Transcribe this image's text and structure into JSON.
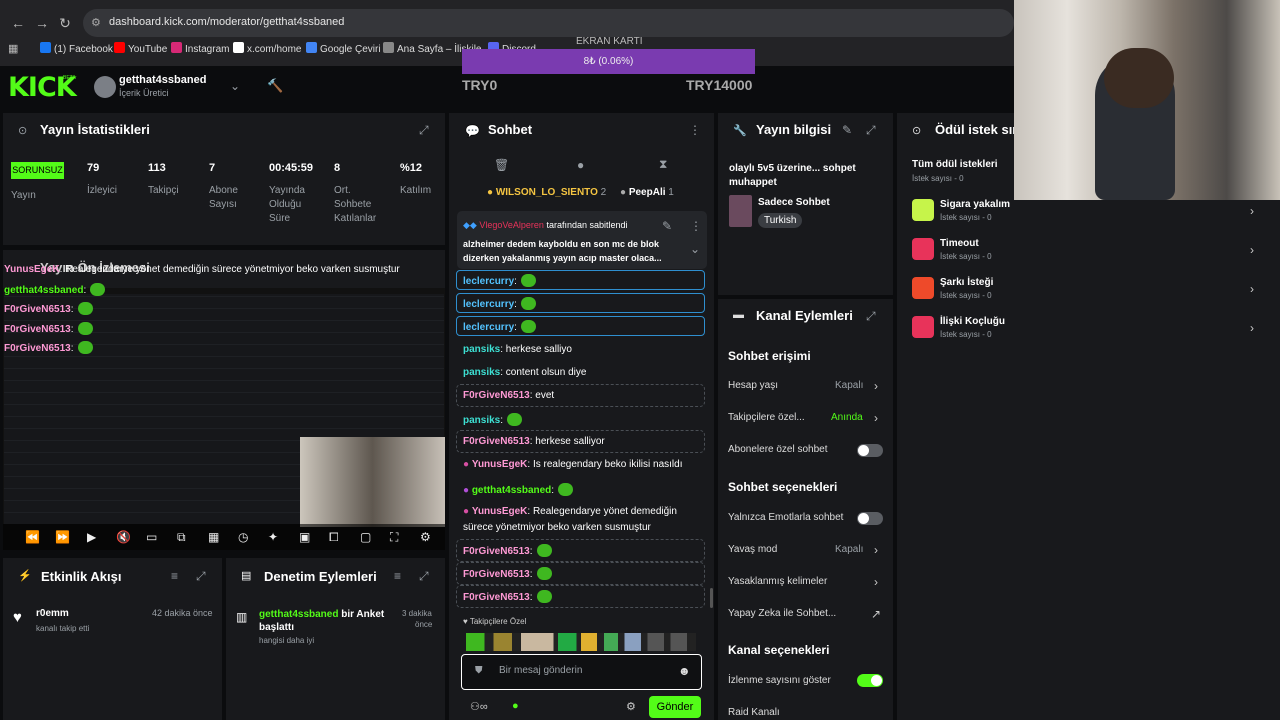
{
  "browser": {
    "url": "dashboard.kick.com/moderator/getthat4ssbaned",
    "bookmarks": [
      {
        "label": "(1) Facebook",
        "color": "#1877f2"
      },
      {
        "label": "YouTube",
        "color": "#ff0000"
      },
      {
        "label": "Instagram",
        "color": "#d62976"
      },
      {
        "label": "x.com/home",
        "color": "#ffffff"
      },
      {
        "label": "Google Çeviri",
        "color": "#4285f4"
      },
      {
        "label": "Ana Sayfa – İlişkile",
        "color": "#888888"
      },
      {
        "label": "Discord",
        "color": "#5865f2"
      }
    ]
  },
  "overlay": {
    "title": "EKRAN KARTI",
    "progress_label": "8₺ (0.06%)",
    "progress": 0.06,
    "min_label": "TRY0",
    "max_label": "TRY14000"
  },
  "header": {
    "logo": "KICK",
    "beta": "BETA",
    "username": "getthat4ssbaned",
    "role": "İçerik Üretici"
  },
  "stats": {
    "title": "Yayın İstatistikleri",
    "badge": "SORUNSUZ",
    "badge_label": "Yayın",
    "items": [
      {
        "value": "79",
        "label": "İzleyici"
      },
      {
        "value": "113",
        "label": "Takipçi"
      },
      {
        "value": "7",
        "label": "Abone Sayısı"
      },
      {
        "value": "00:45:59",
        "label": "Yayında Olduğu Süre"
      },
      {
        "value": "8",
        "label": "Ort. Sohbete Katılanlar"
      },
      {
        "value": "%12",
        "label": "Katılım"
      }
    ]
  },
  "preview": {
    "title": "Yayın Ön İzlemesi",
    "overlay_msgs": [
      {
        "user": "YunusEgeK",
        "text": ": Realegendarye yönet demediğin sürece yönetmiyor beko varken susmuştur"
      },
      {
        "user": "getthat4ssbaned",
        "text": ":"
      },
      {
        "user": "F0rGiveN6513",
        "text": ":"
      },
      {
        "user": "F0rGiveN6513",
        "text": ":"
      },
      {
        "user": "F0rGiveN6513",
        "text": ":"
      }
    ]
  },
  "activity": {
    "title": "Etkinlik Akışı",
    "user": "r0emm",
    "action": "kanalı takip etti",
    "time": "42 dakika önce"
  },
  "moderation": {
    "title": "Denetim Eylemleri",
    "user": "getthat4ssbaned",
    "action": "bir Anket başlattı",
    "sub": "hangisi daha iyi",
    "time_a": "3 dakika",
    "time_b": "önce"
  },
  "chat": {
    "title": "Sohbet",
    "top_users": [
      {
        "name": "WILSON_LO_SIENTO",
        "count": "2"
      },
      {
        "name": "PeepAli",
        "count": "1"
      }
    ],
    "pinned": {
      "by_user": "VlegoVeAlperen",
      "by_text": "tarafından sabitlendi",
      "text_a": "alzheimer dedem kayboldu en son mc de blok",
      "text_b": "dizerken yakalanmış yayın acıp master olaca..."
    },
    "messages": [
      {
        "user": "leclercurry",
        "text": ":",
        "color": "#53c3ff"
      },
      {
        "user": "leclercurry",
        "text": ":",
        "color": "#53c3ff"
      },
      {
        "user": "leclercurry",
        "text": ":",
        "color": "#53c3ff"
      },
      {
        "user": "pansiks",
        "text": ": herkese salliyo",
        "color": "#3de0d3"
      },
      {
        "user": "pansiks",
        "text": ": content olsun diye",
        "color": "#3de0d3"
      },
      {
        "user": "F0rGiveN6513",
        "text": ": evet",
        "color": "#ff9ad5"
      },
      {
        "user": "pansiks",
        "text": ":",
        "color": "#3de0d3"
      },
      {
        "user": "F0rGiveN6513",
        "text": ": herkese salliyor",
        "color": "#ff9ad5"
      },
      {
        "user": "YunusEgeK",
        "text": ": Is realegendary beko ikilisi nasıldı",
        "color": "#ff9ad5"
      },
      {
        "user": "getthat4ssbaned",
        "text": ":",
        "color": "#53fc18"
      },
      {
        "user": "YunusEgeK",
        "text": ": Realegendarye yönet demediğin",
        "color": "#ff9ad5",
        "text2": "sürece yönetmiyor beko varken susmuştur"
      },
      {
        "user": "F0rGiveN6513",
        "text": ":",
        "color": "#ff9ad5"
      },
      {
        "user": "F0rGiveN6513",
        "text": ":",
        "color": "#ff9ad5"
      },
      {
        "user": "F0rGiveN6513",
        "text": ":",
        "color": "#ff9ad5"
      }
    ],
    "emote_label": "Takipçilere Özel",
    "placeholder": "Bir mesaj gönderin",
    "send": "Gönder"
  },
  "stream_info": {
    "title": "Yayın bilgisi",
    "stream_title": "olaylı 5v5 üzerine... sohpet muhappet",
    "category": "Sadece Sohbet",
    "language": "Turkish"
  },
  "channel_actions": {
    "title": "Kanal Eylemleri",
    "chat_access": "Sohbet erişimi",
    "account_age": "Hesap yaşı",
    "account_age_val": "Kapalı",
    "followers_only": "Takipçilere özel...",
    "followers_only_val": "Anında",
    "subs_only": "Abonelere özel sohbet",
    "chat_options": "Sohbet seçenekleri",
    "emote_only": "Yalnızca Emotlarla sohbet",
    "slow_mode": "Yavaş mod",
    "slow_mode_val": "Kapalı",
    "banned_words": "Yasaklanmış kelimeler",
    "ai_chat": "Yapay Zeka ile Sohbet...",
    "channel_options": "Kanal seçenekleri",
    "show_viewers": "İzlenme sayısını göster",
    "raid": "Raid Kanalı"
  },
  "rewards": {
    "title": "Ödül istek sır",
    "all": "Tüm ödül istekleri",
    "all_sub": "İstek sayısı - 0",
    "items": [
      {
        "name": "Sigara yakalım",
        "sub": "İstek sayısı - 0",
        "color": "#c6f44a"
      },
      {
        "name": "Timeout",
        "sub": "İstek sayısı - 0",
        "color": "#e8335a"
      },
      {
        "name": "Şarkı İsteği",
        "sub": "İstek sayısı - 0",
        "color": "#ee4a2a"
      },
      {
        "name": "İlişki Koçluğu",
        "sub": "İstek sayısı - 0",
        "color": "#e8335a"
      }
    ]
  }
}
